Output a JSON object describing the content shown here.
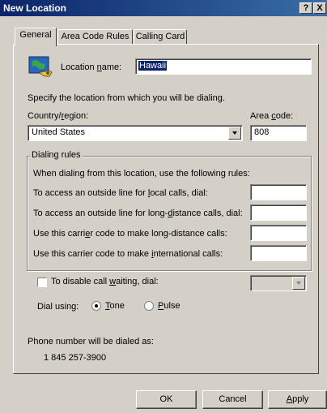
{
  "window": {
    "title": "New Location",
    "help_button": "?",
    "close_button": "X"
  },
  "tabs": [
    {
      "label": "General",
      "active": true
    },
    {
      "label": "Area Code Rules",
      "active": false
    },
    {
      "label": "Calling Card",
      "active": false
    }
  ],
  "general": {
    "location_name_label_pre": "Location ",
    "location_name_label_key": "n",
    "location_name_label_post": "ame:",
    "location_name_value": "Hawaii",
    "specify_text": "Specify the location from which you will be dialing.",
    "country_label_pre": "Country/",
    "country_label_key": "r",
    "country_label_post": "egion:",
    "country_value": "United States",
    "area_code_label_pre": "Area ",
    "area_code_label_key": "c",
    "area_code_label_post": "ode:",
    "area_code_value": "808"
  },
  "dialing_rules": {
    "group_label": "Dialing rules",
    "intro": "When dialing from this location, use the following rules:",
    "local_pre": "To access an outside line for ",
    "local_key": "l",
    "local_post": "ocal calls, dial:",
    "local_value": "",
    "long_pre": "To access an outside line for long-",
    "long_key": "d",
    "long_post": "istance calls, dial:",
    "long_value": "",
    "carrier_long_pre": "Use this carri",
    "carrier_long_key": "e",
    "carrier_long_post": "r code to make long-distance calls:",
    "carrier_long_value": "",
    "carrier_intl_pre": "Use this carrier code to make ",
    "carrier_intl_key": "i",
    "carrier_intl_post": "nternational calls:",
    "carrier_intl_value": ""
  },
  "call_waiting": {
    "label_pre": "To disable call ",
    "label_key": "w",
    "label_post": "aiting, dial:",
    "checked": false,
    "value": ""
  },
  "dial_using": {
    "label": "Dial using:",
    "tone_key": "T",
    "tone_post": "one",
    "pulse_key": "P",
    "pulse_post": "ulse",
    "selected": "Tone"
  },
  "phone_preview": {
    "label": "Phone number will be dialed as:",
    "number": "1 845 257-3900"
  },
  "buttons": {
    "ok": "OK",
    "cancel": "Cancel",
    "apply_key": "A",
    "apply_post": "pply"
  }
}
